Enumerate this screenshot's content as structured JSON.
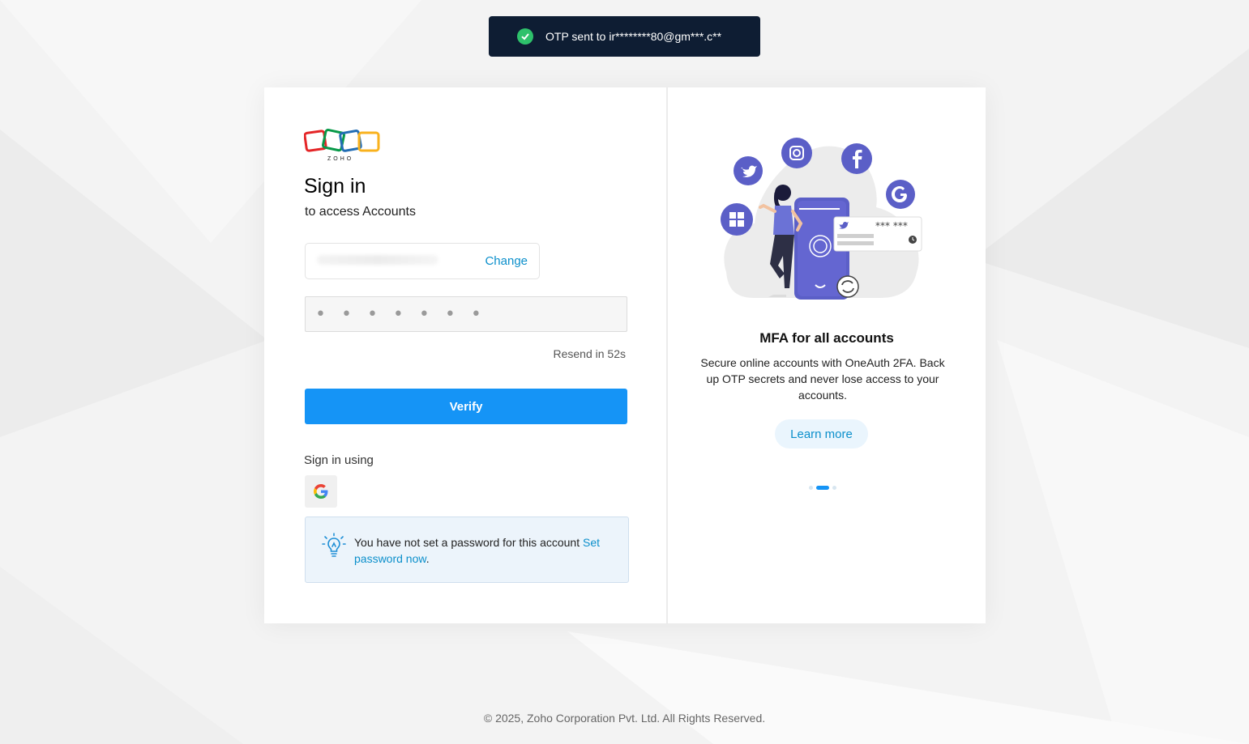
{
  "toast": {
    "message": "OTP sent to ir********80@gm***.c**"
  },
  "brand": {
    "logo_text": "ZOHO"
  },
  "signin": {
    "title": "Sign in",
    "subtitle": "to access Accounts",
    "change_label": "Change",
    "otp_placeholder": "• • • • • • •",
    "resend_text": "Resend in 52s",
    "verify_label": "Verify",
    "signin_using_label": "Sign in using"
  },
  "info": {
    "text": "You have not set a password for this account ",
    "link_text": "Set password now",
    "suffix": "."
  },
  "promo": {
    "masked_text": "*** ***",
    "title": "MFA for all accounts",
    "description": "Secure online accounts with OneAuth 2FA. Back up OTP secrets and never lose access to your accounts.",
    "button_label": "Learn more",
    "slide_count": 3,
    "active_slide": 2
  },
  "footer": {
    "copyright": "© 2025, Zoho Corporation Pvt. Ltd. All Rights Reserved."
  },
  "colors": {
    "accent": "#1594f6",
    "link": "#0b8fcb",
    "toast_bg": "#0e1d33",
    "success": "#2ec16b",
    "illustration": "#5b5fc7"
  }
}
